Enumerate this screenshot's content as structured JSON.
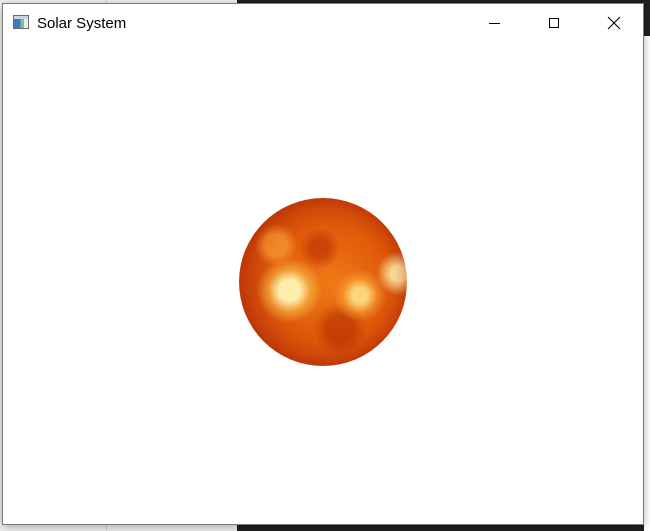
{
  "window": {
    "title": "Solar System",
    "app_icon": "application-window-icon",
    "controls": {
      "minimize_icon": "minimize-icon",
      "maximize_icon": "maximize-icon",
      "close_icon": "close-icon"
    }
  },
  "scene": {
    "object": "sun",
    "colors": {
      "core": "#e05a0a",
      "highlight": "#fff0b4",
      "rim": "#f6b040"
    }
  },
  "background": {
    "window_color": "#ffffff",
    "desktop_left_color": "#f0f0f0",
    "desktop_right_color": "#1f1f1f"
  }
}
